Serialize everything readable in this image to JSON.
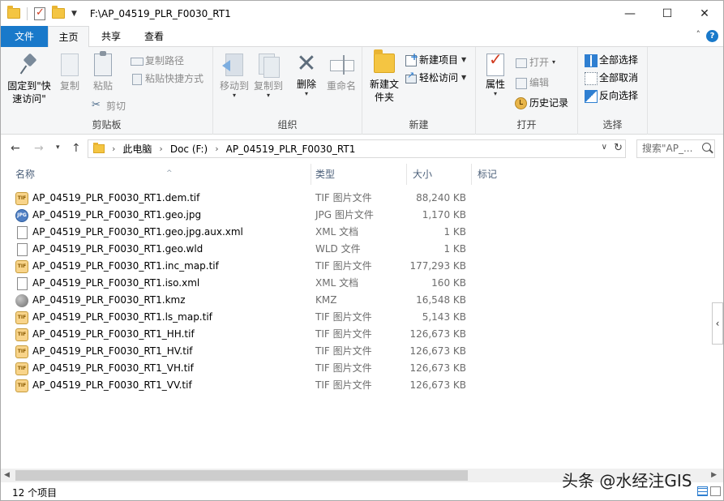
{
  "window": {
    "title": "F:\\AP_04519_PLR_F0030_RT1",
    "minimize": "—",
    "maximize": "☐",
    "close": "✕"
  },
  "tabs": {
    "file": "文件",
    "home": "主页",
    "share": "共享",
    "view": "查看"
  },
  "ribbon": {
    "clipboard": {
      "label": "剪贴板",
      "pin": "固定到\"快速访问\"",
      "copy": "复制",
      "paste": "粘贴",
      "copy_path": "复制路径",
      "paste_shortcut": "粘贴快捷方式",
      "cut": "剪切"
    },
    "organize": {
      "label": "组织",
      "move_to": "移动到",
      "copy_to": "复制到",
      "delete": "删除",
      "rename": "重命名"
    },
    "new": {
      "label": "新建",
      "new_folder": "新建文件夹",
      "new_item": "新建项目",
      "easy_access": "轻松访问"
    },
    "open": {
      "label": "打开",
      "properties": "属性",
      "open": "打开",
      "edit": "编辑",
      "history": "历史记录"
    },
    "select": {
      "label": "选择",
      "select_all": "全部选择",
      "select_none": "全部取消",
      "invert": "反向选择"
    }
  },
  "address": {
    "crumbs": [
      "此电脑",
      "Doc (F:)",
      "AP_04519_PLR_F0030_RT1"
    ],
    "search_placeholder": "搜索\"AP_..."
  },
  "columns": {
    "name": "名称",
    "type": "类型",
    "size": "大小",
    "tags": "标记"
  },
  "files": [
    {
      "name": "AP_04519_PLR_F0030_RT1.dem.tif",
      "type": "TIF 图片文件",
      "size": "88,240 KB",
      "icon": "tif-file-icon"
    },
    {
      "name": "AP_04519_PLR_F0030_RT1.geo.jpg",
      "type": "JPG 图片文件",
      "size": "1,170 KB",
      "icon": "jpg-file-icon"
    },
    {
      "name": "AP_04519_PLR_F0030_RT1.geo.jpg.aux.xml",
      "type": "XML 文档",
      "size": "1 KB",
      "icon": "document-icon"
    },
    {
      "name": "AP_04519_PLR_F0030_RT1.geo.wld",
      "type": "WLD 文件",
      "size": "1 KB",
      "icon": "document-icon"
    },
    {
      "name": "AP_04519_PLR_F0030_RT1.inc_map.tif",
      "type": "TIF 图片文件",
      "size": "177,293 KB",
      "icon": "tif-file-icon"
    },
    {
      "name": "AP_04519_PLR_F0030_RT1.iso.xml",
      "type": "XML 文档",
      "size": "160 KB",
      "icon": "document-icon"
    },
    {
      "name": "AP_04519_PLR_F0030_RT1.kmz",
      "type": "KMZ",
      "size": "16,548 KB",
      "icon": "kmz-file-icon"
    },
    {
      "name": "AP_04519_PLR_F0030_RT1.ls_map.tif",
      "type": "TIF 图片文件",
      "size": "5,143 KB",
      "icon": "tif-file-icon"
    },
    {
      "name": "AP_04519_PLR_F0030_RT1_HH.tif",
      "type": "TIF 图片文件",
      "size": "126,673 KB",
      "icon": "tif-file-icon"
    },
    {
      "name": "AP_04519_PLR_F0030_RT1_HV.tif",
      "type": "TIF 图片文件",
      "size": "126,673 KB",
      "icon": "tif-file-icon"
    },
    {
      "name": "AP_04519_PLR_F0030_RT1_VH.tif",
      "type": "TIF 图片文件",
      "size": "126,673 KB",
      "icon": "tif-file-icon"
    },
    {
      "name": "AP_04519_PLR_F0030_RT1_VV.tif",
      "type": "TIF 图片文件",
      "size": "126,673 KB",
      "icon": "tif-file-icon"
    }
  ],
  "status": {
    "item_count": "12 个项目",
    "watermark": "头条 @水经注GIS"
  },
  "colors": {
    "accent": "#1979ca",
    "ribbon_bg": "#f5f6f7",
    "header_text": "#4c607a"
  }
}
